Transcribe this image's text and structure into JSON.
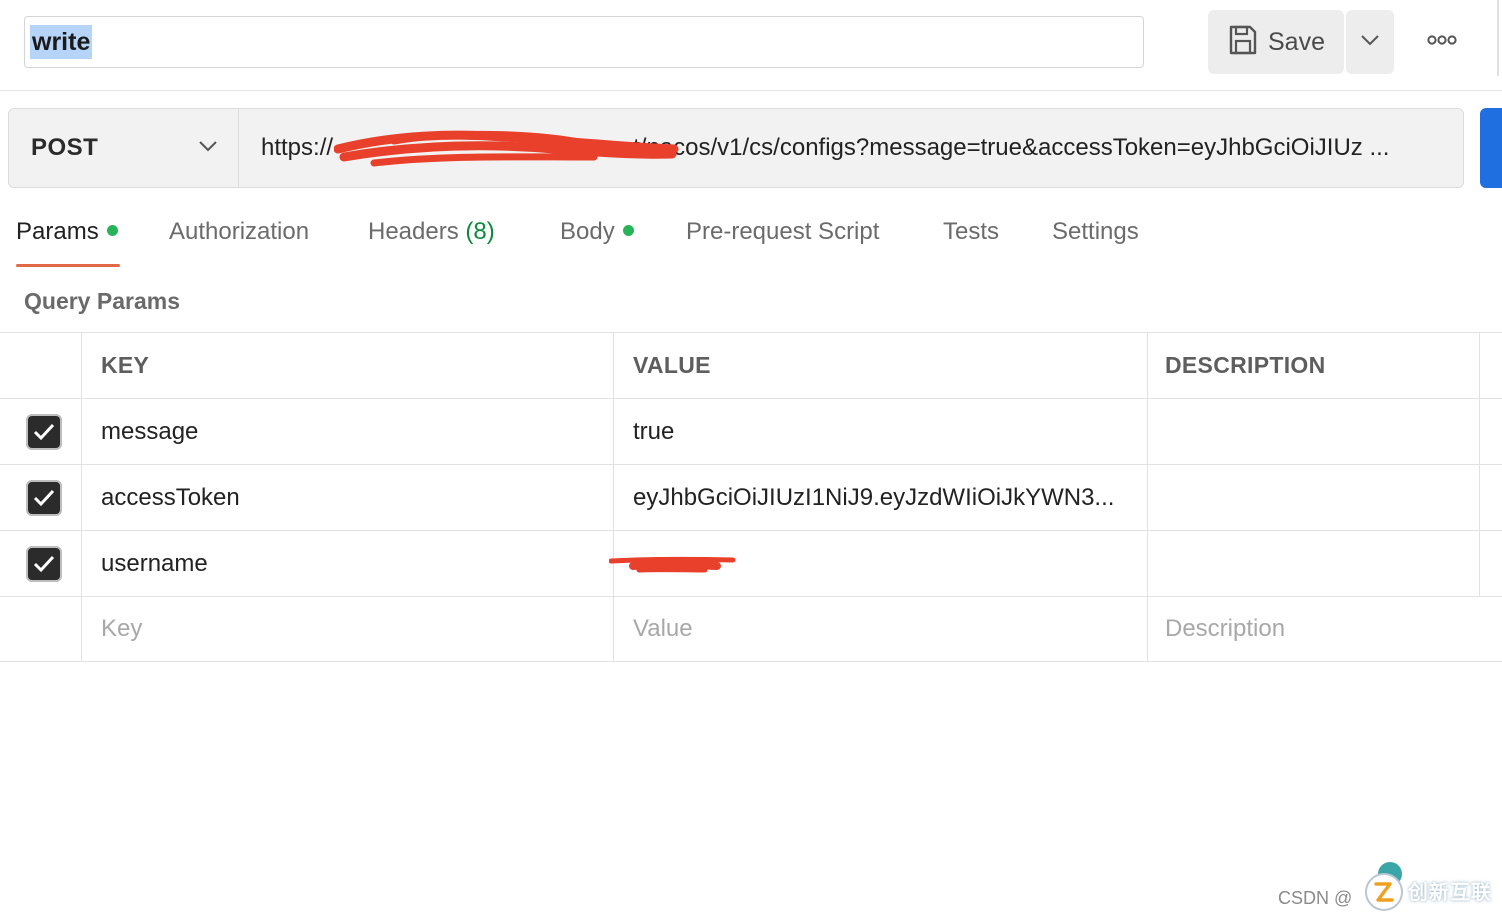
{
  "request": {
    "name": "write",
    "method": "POST",
    "url": "https://                                        .net/nacos/v1/cs/configs?message=true&accessToken=eyJhbGciOiJIUz ..."
  },
  "toolbar": {
    "save_label": "Save"
  },
  "tabs": [
    {
      "label": "Params",
      "dot": true
    },
    {
      "label": "Authorization"
    },
    {
      "label": "Headers",
      "count": "(8)"
    },
    {
      "label": "Body",
      "dot": true
    },
    {
      "label": "Pre-request Script"
    },
    {
      "label": "Tests"
    },
    {
      "label": "Settings"
    }
  ],
  "params": {
    "section_title": "Query Params",
    "columns": [
      "KEY",
      "VALUE",
      "DESCRIPTION"
    ],
    "rows": [
      {
        "key": "message",
        "value": "true",
        "description": "",
        "checked": true
      },
      {
        "key": "accessToken",
        "value": "eyJhbGciOiJIUzI1NiJ9.eyJzdWIiOiJkYWN3...",
        "description": "",
        "checked": true
      },
      {
        "key": "username",
        "value": "",
        "description": "",
        "checked": true,
        "redacted": true
      }
    ],
    "placeholders": {
      "key": "Key",
      "value": "Value",
      "description": "Description"
    }
  },
  "watermark": {
    "prefix": "CSDN @",
    "brand": "创新互联"
  },
  "colors": {
    "accent_tab": "#e06a45",
    "dot_green": "#27b358",
    "send_blue": "#1f6fe0",
    "redaction": "#e8402a"
  }
}
